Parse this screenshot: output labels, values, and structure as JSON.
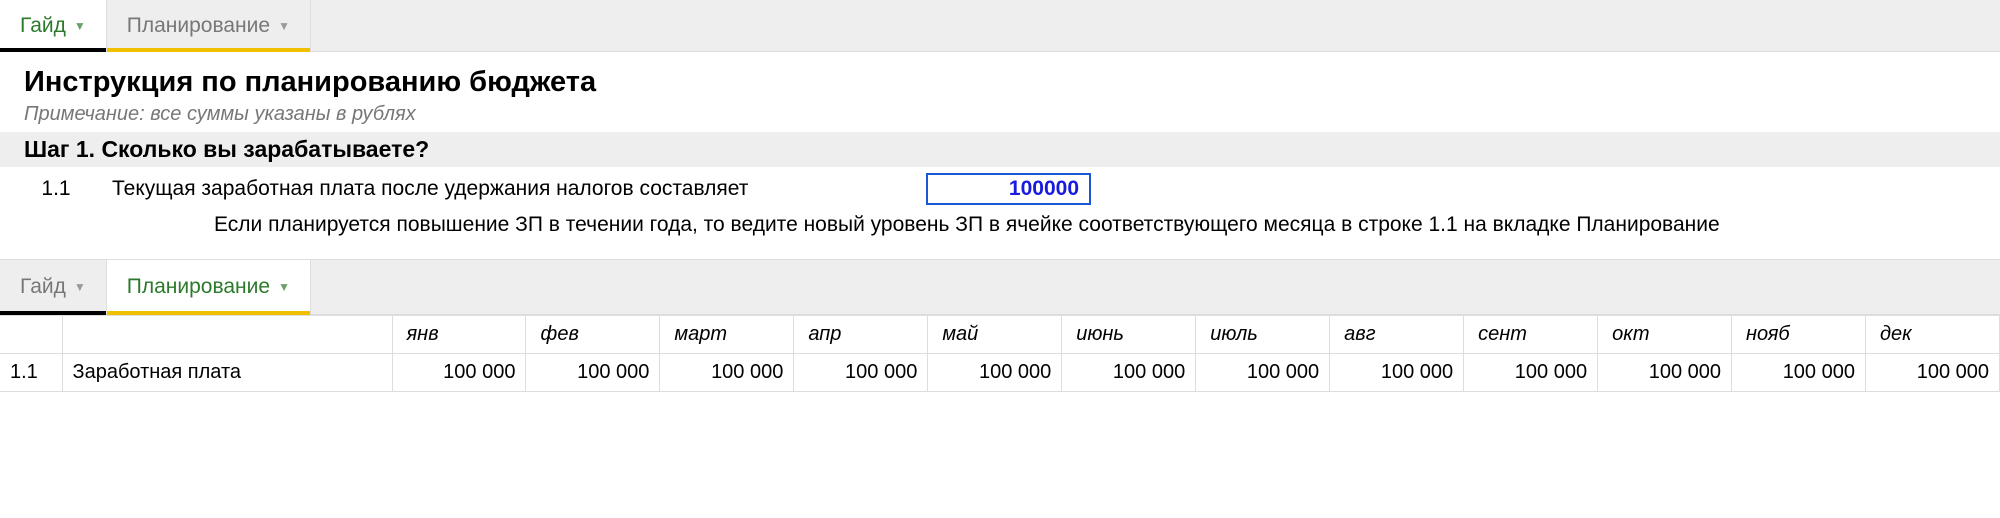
{
  "tabs_top": {
    "guide": "Гайд",
    "planning": "Планирование"
  },
  "doc": {
    "title": "Инструкция по планированию бюджета",
    "note": "Примечание: все суммы указаны в рублях",
    "step1_header": "Шаг 1. Сколько вы зарабатываете?",
    "row_1_1_num": "1.1",
    "row_1_1_text": "Текущая заработная плата после удержания налогов составляет",
    "row_1_1_value": "100000",
    "row_1_1_hint": "Если планируется повышение ЗП в течении года, то ведите новый уровень ЗП в ячейке соответствующего месяца в строке 1.1 на вкладке Планирование"
  },
  "tabs_bottom": {
    "guide": "Гайд",
    "planning": "Планирование"
  },
  "planning": {
    "months": [
      "янв",
      "фев",
      "март",
      "апр",
      "май",
      "июнь",
      "июль",
      "авг",
      "сент",
      "окт",
      "нояб",
      "дек"
    ],
    "row_num": "1.1",
    "row_label": "Заработная плата",
    "values": [
      "100 000",
      "100 000",
      "100 000",
      "100 000",
      "100 000",
      "100 000",
      "100 000",
      "100 000",
      "100 000",
      "100 000",
      "100 000",
      "100 000"
    ]
  },
  "colors": {
    "accent_green": "#2b7a2b",
    "input_border": "#1a56d6",
    "input_text": "#1a1adf",
    "yellow": "#f0c000"
  }
}
